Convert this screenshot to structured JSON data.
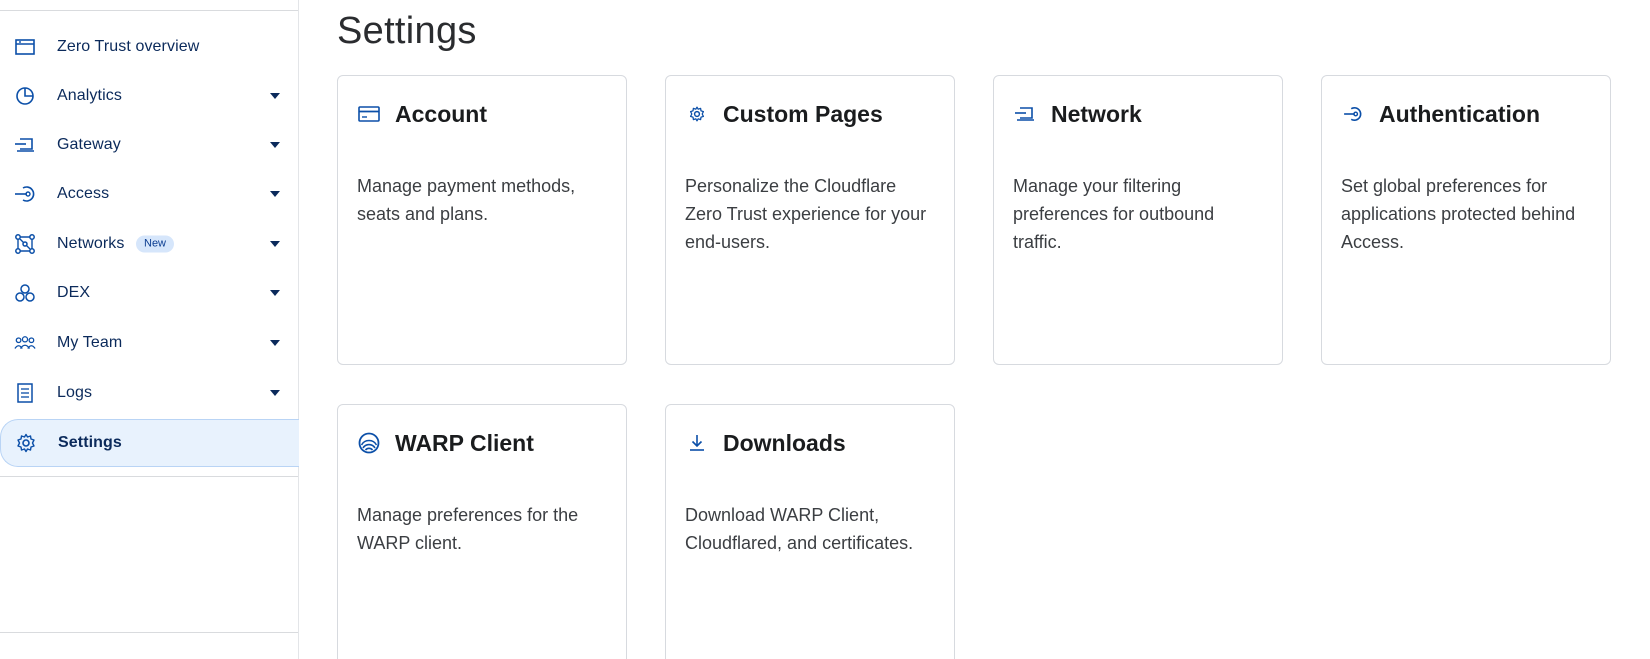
{
  "sidebar": {
    "items": [
      {
        "label": "Zero Trust overview",
        "icon": "browser-window-icon",
        "has_caret": false
      },
      {
        "label": "Analytics",
        "icon": "pie-chart-icon",
        "has_caret": true
      },
      {
        "label": "Gateway",
        "icon": "gateway-icon",
        "has_caret": true
      },
      {
        "label": "Access",
        "icon": "access-login-icon",
        "has_caret": true
      },
      {
        "label": "Networks",
        "icon": "network-nodes-icon",
        "has_caret": true,
        "badge": "New"
      },
      {
        "label": "DEX",
        "icon": "dex-icon",
        "has_caret": true
      },
      {
        "label": "My Team",
        "icon": "team-icon",
        "has_caret": true
      },
      {
        "label": "Logs",
        "icon": "logs-icon",
        "has_caret": true
      },
      {
        "label": "Settings",
        "icon": "gear-icon",
        "has_caret": false,
        "active": true
      }
    ]
  },
  "main": {
    "title": "Settings",
    "cards": [
      {
        "title": "Account",
        "icon": "credit-card-icon",
        "description": "Manage payment methods, seats and plans."
      },
      {
        "title": "Custom Pages",
        "icon": "gear-icon",
        "description": "Personalize the Cloudflare Zero Trust experience for your end-users."
      },
      {
        "title": "Network",
        "icon": "gateway-icon",
        "description": "Manage your filtering preferences for outbound traffic."
      },
      {
        "title": "Authentication",
        "icon": "access-login-icon",
        "description": "Set global preferences for applications protected behind Access."
      },
      {
        "title": "WARP Client",
        "icon": "warp-icon",
        "description": "Manage preferences for the WARP client."
      },
      {
        "title": "Downloads",
        "icon": "download-icon",
        "description": "Download WARP Client, Cloudflared, and certificates."
      }
    ]
  },
  "colors": {
    "accent": "#0b4fa8",
    "nav_text": "#0b2a5b",
    "active_bg": "#e8f2fd",
    "badge_bg": "#d6e6fb"
  }
}
